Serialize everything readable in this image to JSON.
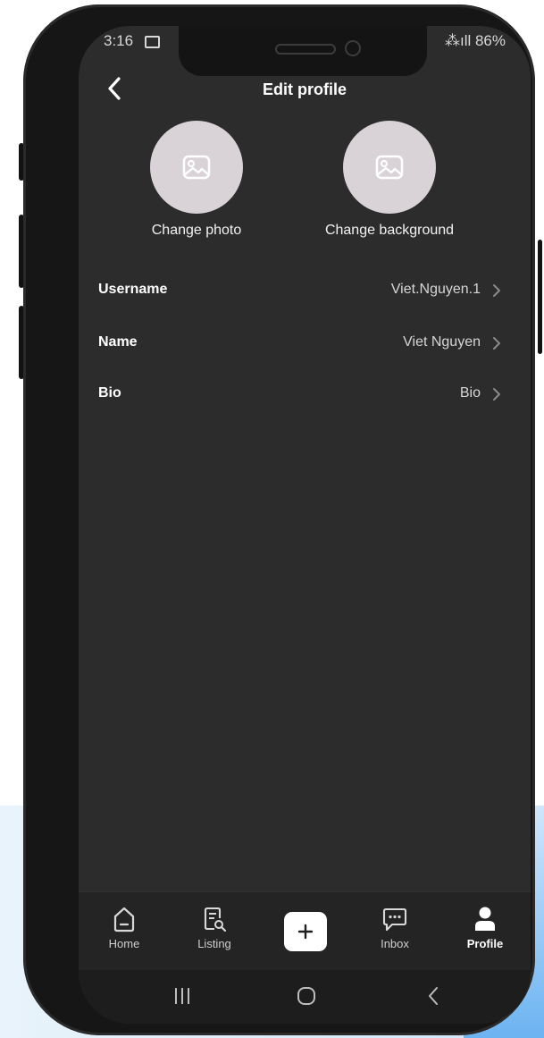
{
  "status_bar": {
    "time": "3:16",
    "right": "⁂ıll 86%"
  },
  "header": {
    "title": "Edit profile",
    "back_icon": "chevron-left-icon"
  },
  "media": {
    "photo_label": "Change photo",
    "background_label": "Change background",
    "placeholder_icon": "image-icon"
  },
  "fields": [
    {
      "label": "Username",
      "value": "Viet.Nguyen.1"
    },
    {
      "label": "Name",
      "value": "Viet Nguyen"
    },
    {
      "label": "Bio",
      "value": "Bio"
    }
  ],
  "tabs": [
    {
      "label": "Home",
      "icon": "home-icon"
    },
    {
      "label": "Listing",
      "icon": "listing-icon"
    },
    {
      "label": "",
      "icon": "plus-icon"
    },
    {
      "label": "Inbox",
      "icon": "chat-icon"
    },
    {
      "label": "Profile",
      "icon": "person-icon",
      "active": true
    }
  ],
  "system_nav": [
    "recent-apps-icon",
    "home-circle-icon",
    "back-icon"
  ],
  "colors": {
    "screen_bg": "#2c2c2c",
    "tabbar_bg": "#242424",
    "avatar_bg": "#d9d3d7",
    "text_primary": "#ffffff"
  }
}
